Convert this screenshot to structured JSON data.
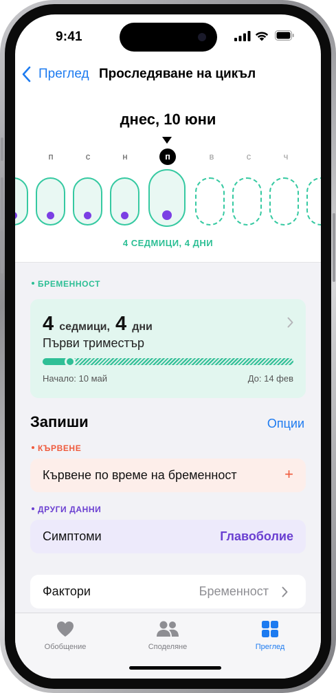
{
  "status": {
    "time": "9:41"
  },
  "nav": {
    "back_label": "Преглед",
    "title": "Проследяване на цикъл"
  },
  "date_title": "днес, 10 юни",
  "weekdays": [
    "п",
    "п",
    "с",
    "ч",
    "п",
    "в",
    "с",
    "ч"
  ],
  "weekdays_shown": {
    "d1": "п",
    "d2": "с",
    "d3": "н",
    "d4": "п",
    "d5": "в",
    "d6": "с",
    "d7": "ч"
  },
  "weeks_label": "4 СЕДМИЦИ, 4 ДНИ",
  "pregnancy": {
    "section_label": "БРЕМЕННОСТ",
    "weeks_value": "4",
    "weeks_unit": "седмици,",
    "days_value": "4",
    "days_unit": "дни",
    "trimester": "Първи триместър",
    "progress_fraction": 0.11,
    "start_label": "Начало: 10 май",
    "end_label": "До: 14 фев"
  },
  "log": {
    "title": "Запиши",
    "options_label": "Опции"
  },
  "bleeding": {
    "section_label": "КЪРВЕНЕ",
    "row_label": "Кървене по време на бременност",
    "add_symbol": "+"
  },
  "other": {
    "section_label": "ДРУГИ ДАННИ",
    "symptoms_label": "Симптоми",
    "symptoms_value": "Главоболие"
  },
  "factors": {
    "label": "Фактори",
    "value": "Бременност"
  },
  "tabs": {
    "summary": "Обобщение",
    "sharing": "Споделяне",
    "browse": "Преглед"
  },
  "colors": {
    "accent": "#1d7bf0",
    "teal": "#2fbf96",
    "purple": "#6a3fd1",
    "red": "#ef5a3c"
  }
}
